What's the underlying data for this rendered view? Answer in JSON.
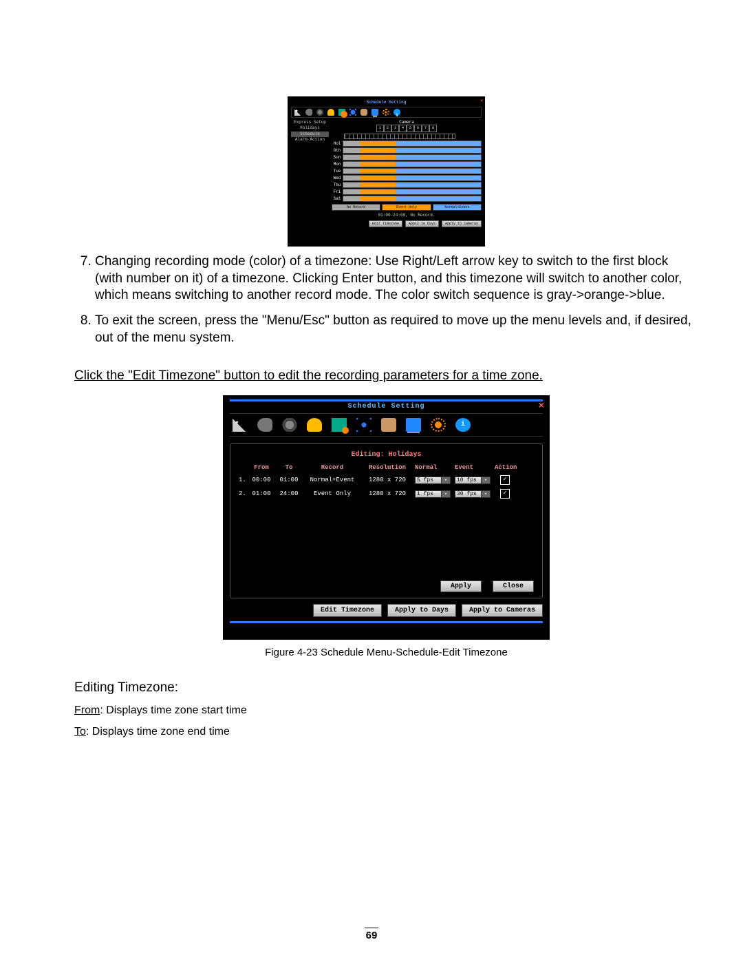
{
  "list_start": 7,
  "items": [
    "Changing recording mode (color) of a timezone: Use Right/Left arrow key to switch to the first block (with number on it) of a timezone. Clicking Enter button, and this timezone will switch to another color, which means switching to another record mode. The color switch sequence is gray->orange->blue.",
    "To exit the screen, press the \"Menu/Esc\" button as required to move up the menu levels and, if desired, out of the menu system."
  ],
  "click_line": "Click the \"Edit Timezone\" button to edit the recording parameters for a time zone.",
  "caption": "Figure 4-23 Schedule Menu-Schedule-Edit Timezone",
  "desc_title": "Editing Timezone:",
  "desc_from_label": "From",
  "desc_from": "Displays time zone start time",
  "desc_to_label": "To",
  "desc_to": "Displays time zone end time",
  "page_number": "69",
  "mini": {
    "title": "Schedule Setting",
    "side": [
      "Express Setup",
      "Holidays",
      "Schedule",
      "Alarm Action"
    ],
    "side_selected_index": 2,
    "camera_label": "Camera",
    "cameras": [
      "1",
      "2",
      "3",
      "4",
      "5",
      "6",
      "7",
      "8"
    ],
    "days": [
      "Hol",
      "Oth",
      "Sun",
      "Mon",
      "Tue",
      "Wed",
      "Thu",
      "Fri",
      "Sat"
    ],
    "legend": [
      "No Record",
      "Event Only",
      "Normal+Event"
    ],
    "note": "01:00-24:00, No Record.",
    "buttons": [
      "Edit Timezone",
      "Apply to Days",
      "Apply to Cameras"
    ]
  },
  "big": {
    "title": "Schedule Setting",
    "editing_label": "Editing: Holidays",
    "headers": {
      "from": "From",
      "to": "To",
      "record": "Record",
      "resolution": "Resolution",
      "normal": "Normal",
      "event": "Event",
      "action": "Action"
    },
    "rows": [
      {
        "idx": "1.",
        "from": "00:00",
        "to": "01:00",
        "record": "Normal+Event",
        "resolution": "1280 x 720",
        "normal": "5 fps",
        "event": "10 fps",
        "action": true
      },
      {
        "idx": "2.",
        "from": "01:00",
        "to": "24:00",
        "record": "Event Only",
        "resolution": "1280 x 720",
        "normal": "1 fps",
        "event": "30 fps",
        "action": true
      }
    ],
    "apply": "Apply",
    "close": "Close",
    "lower_buttons": [
      "Edit Timezone",
      "Apply to Days",
      "Apply to Cameras"
    ]
  }
}
